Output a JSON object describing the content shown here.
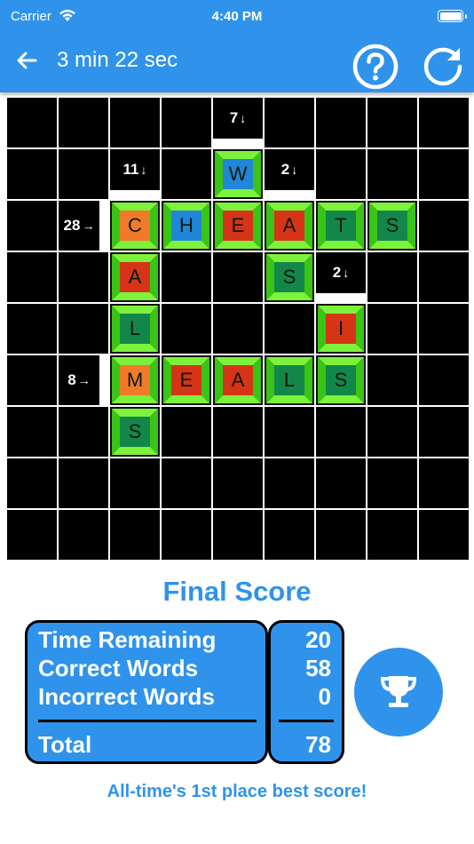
{
  "status_bar": {
    "carrier": "Carrier",
    "time": "4:40 PM"
  },
  "header": {
    "timer": "3 min 22 sec",
    "back_icon": "arrow-left-icon",
    "help_icon": "help-circle-icon",
    "restart_icon": "restart-icon"
  },
  "board": {
    "rows": 9,
    "cols": 9,
    "clues": [
      {
        "label": "7",
        "dir": "↓",
        "row": 0,
        "col": 4
      },
      {
        "label": "11",
        "dir": "↓",
        "row": 1,
        "col": 2
      },
      {
        "label": "2",
        "dir": "↓",
        "row": 1,
        "col": 5
      },
      {
        "label": "28",
        "dir": "→",
        "row": 2,
        "col": 1
      },
      {
        "label": "2",
        "dir": "↓",
        "row": 3,
        "col": 6
      },
      {
        "label": "8",
        "dir": "→",
        "row": 5,
        "col": 1
      }
    ],
    "tiles": [
      {
        "letter": "W",
        "row": 1,
        "col": 4,
        "face": "#1f86d8",
        "rim": "green"
      },
      {
        "letter": "C",
        "row": 2,
        "col": 2,
        "face": "#f07a2a",
        "rim": "green"
      },
      {
        "letter": "H",
        "row": 2,
        "col": 3,
        "face": "#1f86d8",
        "rim": "green"
      },
      {
        "letter": "E",
        "row": 2,
        "col": 4,
        "face": "#d63416",
        "rim": "green"
      },
      {
        "letter": "A",
        "row": 2,
        "col": 5,
        "face": "#d63416",
        "rim": "green"
      },
      {
        "letter": "T",
        "row": 2,
        "col": 6,
        "face": "#13874a",
        "rim": "green"
      },
      {
        "letter": "S",
        "row": 2,
        "col": 7,
        "face": "#13874a",
        "rim": "green"
      },
      {
        "letter": "A",
        "row": 3,
        "col": 2,
        "face": "#d63416",
        "rim": "green"
      },
      {
        "letter": "S",
        "row": 3,
        "col": 5,
        "face": "#13874a",
        "rim": "green"
      },
      {
        "letter": "L",
        "row": 4,
        "col": 2,
        "face": "#13874a",
        "rim": "green"
      },
      {
        "letter": "I",
        "row": 4,
        "col": 6,
        "face": "#d63416",
        "rim": "green"
      },
      {
        "letter": "M",
        "row": 5,
        "col": 2,
        "face": "#f07a2a",
        "rim": "green"
      },
      {
        "letter": "E",
        "row": 5,
        "col": 3,
        "face": "#d63416",
        "rim": "green"
      },
      {
        "letter": "A",
        "row": 5,
        "col": 4,
        "face": "#d63416",
        "rim": "green"
      },
      {
        "letter": "L",
        "row": 5,
        "col": 5,
        "face": "#13874a",
        "rim": "green"
      },
      {
        "letter": "S",
        "row": 5,
        "col": 6,
        "face": "#13874a",
        "rim": "green"
      },
      {
        "letter": "S",
        "row": 6,
        "col": 2,
        "face": "#13874a",
        "rim": "green"
      }
    ]
  },
  "score": {
    "title": "Final Score",
    "rows": [
      {
        "label": "Time Remaining",
        "value": "20"
      },
      {
        "label": "Correct Words",
        "value": "58"
      },
      {
        "label": "Incorrect Words",
        "value": "0"
      }
    ],
    "total": {
      "label": "Total",
      "value": "78"
    },
    "trophy_icon": "trophy-icon",
    "message": "All-time's 1st place best score!"
  },
  "colors": {
    "accent": "#2f93ec",
    "rim_light": "#7cf23a",
    "rim_dark": "#39c416"
  }
}
